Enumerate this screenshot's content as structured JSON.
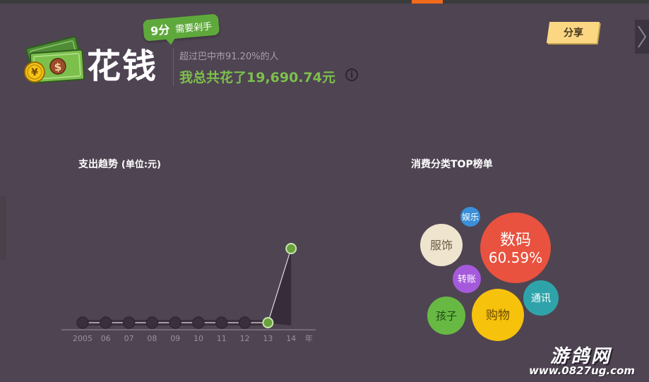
{
  "header": {
    "score_value": "9分",
    "score_text": "需要剁手",
    "title": "花钱",
    "subtitle": "超过巴中市91.20%的人",
    "total": "我总共花了19,690.74元",
    "info_icon": "info-icon",
    "money_icon": "money-bills-icon"
  },
  "share": {
    "label": "分享"
  },
  "nav": {
    "next_icon": "chevron-right-icon"
  },
  "trend": {
    "title": "支出趋势",
    "unit": "(单位:元)",
    "year_suffix": "年"
  },
  "category": {
    "title": "消费分类TOP榜单"
  },
  "colors": {
    "background": "#4f4452",
    "accent_green": "#7cc04c",
    "share_yellow": "#fbd784"
  },
  "chart_data": [
    {
      "type": "line",
      "title": "支出趋势",
      "categories": [
        "2005",
        "06",
        "07",
        "08",
        "09",
        "10",
        "11",
        "12",
        "13",
        "14"
      ],
      "values": [
        0,
        0,
        0,
        0,
        0,
        0,
        0,
        0,
        0,
        19690.74
      ],
      "xlabel": "年",
      "ylabel": "",
      "ylim": [
        0,
        19690.74
      ],
      "grid": false,
      "highlighted_points": [
        "13",
        "14"
      ]
    },
    {
      "type": "bubble",
      "title": "消费分类TOP榜单",
      "items": [
        {
          "label": "数码",
          "value_label": "60.59%",
          "color": "#e8523f",
          "text_color": "#ffffff"
        },
        {
          "label": "购物",
          "value_label": "",
          "color": "#f7c20c",
          "text_color": "#6b4a00"
        },
        {
          "label": "服饰",
          "value_label": "",
          "color": "#efe5cf",
          "text_color": "#6a5a44"
        },
        {
          "label": "孩子",
          "value_label": "",
          "color": "#67b944",
          "text_color": "#214a12"
        },
        {
          "label": "通讯",
          "value_label": "",
          "color": "#2ea4aa",
          "text_color": "#ffffff"
        },
        {
          "label": "转账",
          "value_label": "",
          "color": "#a55adb",
          "text_color": "#ffffff"
        },
        {
          "label": "娱乐",
          "value_label": "",
          "color": "#3a8fd8",
          "text_color": "#ffffff"
        }
      ]
    }
  ],
  "watermark": {
    "main": "游鸽网",
    "url": "www.0827ug.com"
  }
}
